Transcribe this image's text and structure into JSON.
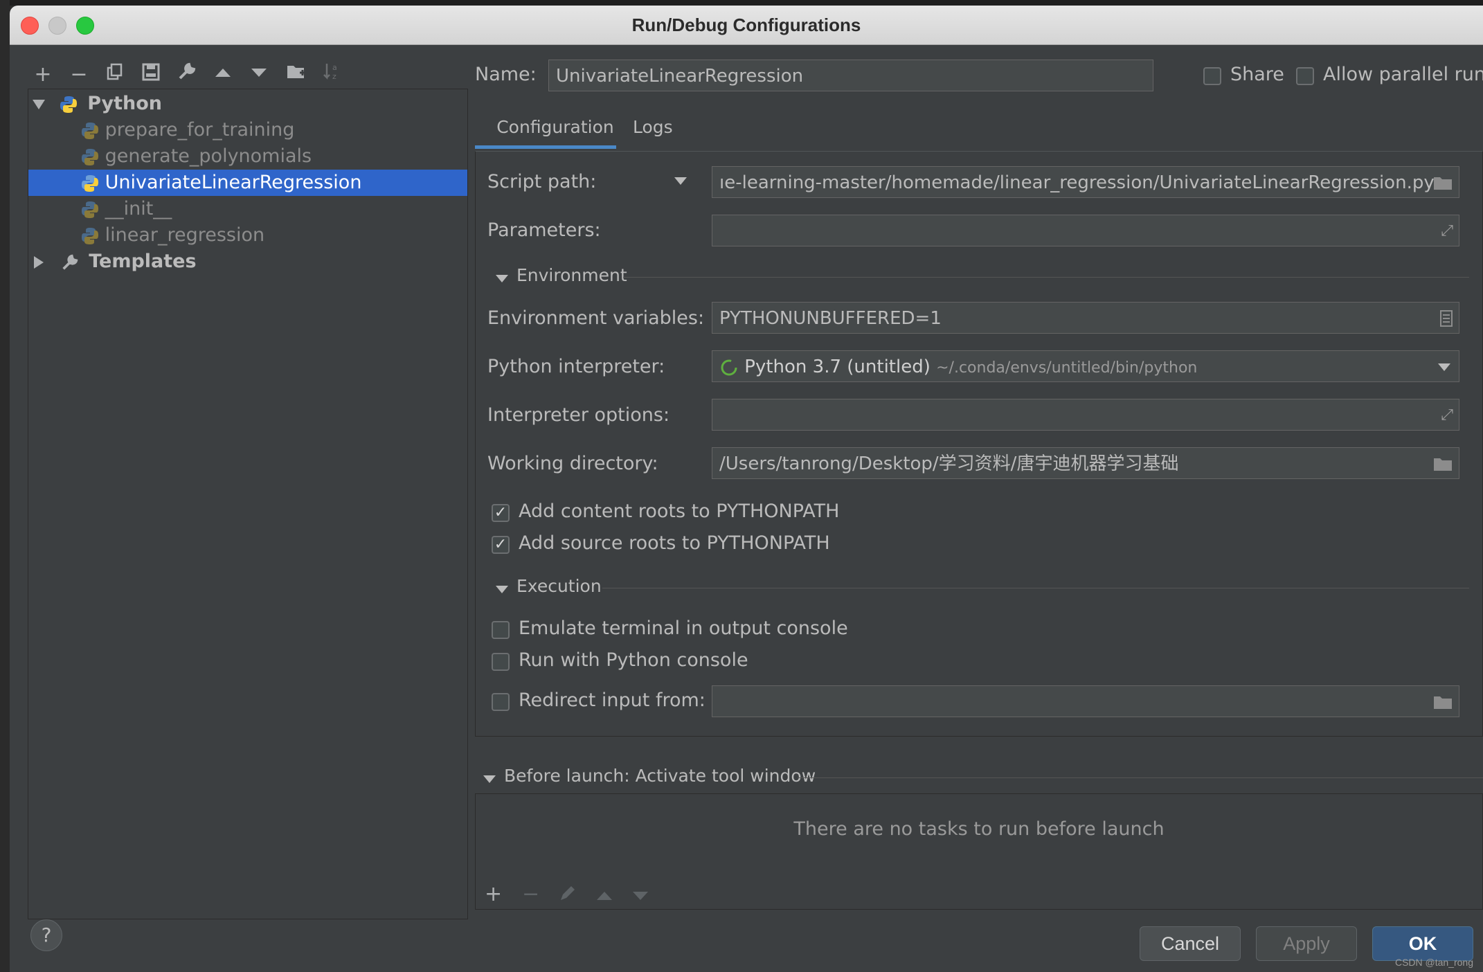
{
  "window": {
    "title": "Run/Debug Configurations"
  },
  "toolbar": {
    "icons": [
      "plus-icon",
      "minus-icon",
      "copy-icon",
      "save-icon",
      "wrench-icon",
      "arrow-up-icon",
      "arrow-down-icon",
      "folder-add-icon",
      "sort-icon"
    ]
  },
  "tree": {
    "python_label": "Python",
    "items": [
      {
        "label": "prepare_for_training"
      },
      {
        "label": "generate_polynomials"
      },
      {
        "label": "UnivariateLinearRegression"
      },
      {
        "label": "__init__"
      },
      {
        "label": "linear_regression"
      }
    ],
    "templates_label": "Templates"
  },
  "header": {
    "name_label": "Name:",
    "name_value": "UnivariateLinearRegression",
    "share_label": "Share",
    "parallel_label": "Allow parallel run"
  },
  "tabs": [
    {
      "label": "Configuration",
      "active": true
    },
    {
      "label": "Logs",
      "active": false
    }
  ],
  "config": {
    "script_path_label": "Script path:",
    "script_path_value": "ıe-learning-master/homemade/linear_regression/UnivariateLinearRegression.py",
    "parameters_label": "Parameters:",
    "parameters_value": "",
    "environment_section": "Environment",
    "env_vars_label": "Environment variables:",
    "env_vars_value": "PYTHONUNBUFFERED=1",
    "interpreter_label": "Python interpreter:",
    "interpreter_name": "Python 3.7 (untitled)",
    "interpreter_path": "~/.conda/envs/untitled/bin/python",
    "interp_options_label": "Interpreter options:",
    "interp_options_value": "",
    "workdir_label": "Working directory:",
    "workdir_value": "/Users/tanrong/Desktop/学习资料/唐宇迪机器学习基础",
    "content_roots_label": "Add content roots to PYTHONPATH",
    "content_roots_checked": true,
    "source_roots_label": "Add source roots to PYTHONPATH",
    "source_roots_checked": true,
    "execution_section": "Execution",
    "emulate_label": "Emulate terminal in output console",
    "emulate_checked": false,
    "python_console_label": "Run with Python console",
    "python_console_checked": false,
    "redirect_label": "Redirect input from:",
    "redirect_checked": false,
    "redirect_value": ""
  },
  "before_launch": {
    "title": "Before launch: Activate tool window",
    "empty_text": "There are no tasks to run before launch"
  },
  "buttons": {
    "cancel": "Cancel",
    "apply": "Apply",
    "ok": "OK",
    "help": "?"
  },
  "watermark": "CSDN @tan_rong",
  "colors": {
    "selection": "#2f65ca",
    "ok_button": "#365880",
    "tab_underline": "#4a88c7",
    "background": "#3c3f41"
  }
}
